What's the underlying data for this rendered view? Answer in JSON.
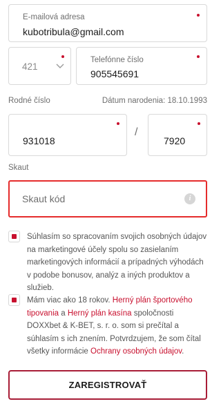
{
  "email": {
    "label": "E-mailová adresa",
    "value": "kubotribula@gmail.com"
  },
  "phone": {
    "prefix": "421",
    "label": "Telefónne číslo",
    "value": "905545691"
  },
  "birth_number": {
    "label": "Rodné číslo",
    "dob_label": "Dátum narodenia: 18.10.1993",
    "part1": "931018",
    "separator": "/",
    "part2": "7920"
  },
  "scout": {
    "label": "Skaut",
    "placeholder": "Skaut kód",
    "info_icon": "i"
  },
  "consent1": {
    "checked": true,
    "text": "Súhlasím so spracovaním svojich osobných údajov na marketingové účely spolu so zasielaním marketingových informácií a prípadných výhodách v podobe bonusov, analýz a iných produktov a služieb."
  },
  "consent2": {
    "checked": true,
    "t1": "Mám viac ako 18 rokov. ",
    "link1": "Herný plán športového tipovania",
    "t2": " a ",
    "link2": "Herný plán kasína",
    "t3": " spoločnosti DOXXbet & K-BET, s. r. o. som si prečítal a súhlasím s ich znením. Potvrdzujem, že som čítal všetky informácie ",
    "link3": "Ochrany osobných údajov",
    "t4": "."
  },
  "register_button": "ZAREGISTROVAŤ",
  "colors": {
    "accent": "#c8102e",
    "error_border": "#e52b2b",
    "button_border": "#a81c36"
  }
}
